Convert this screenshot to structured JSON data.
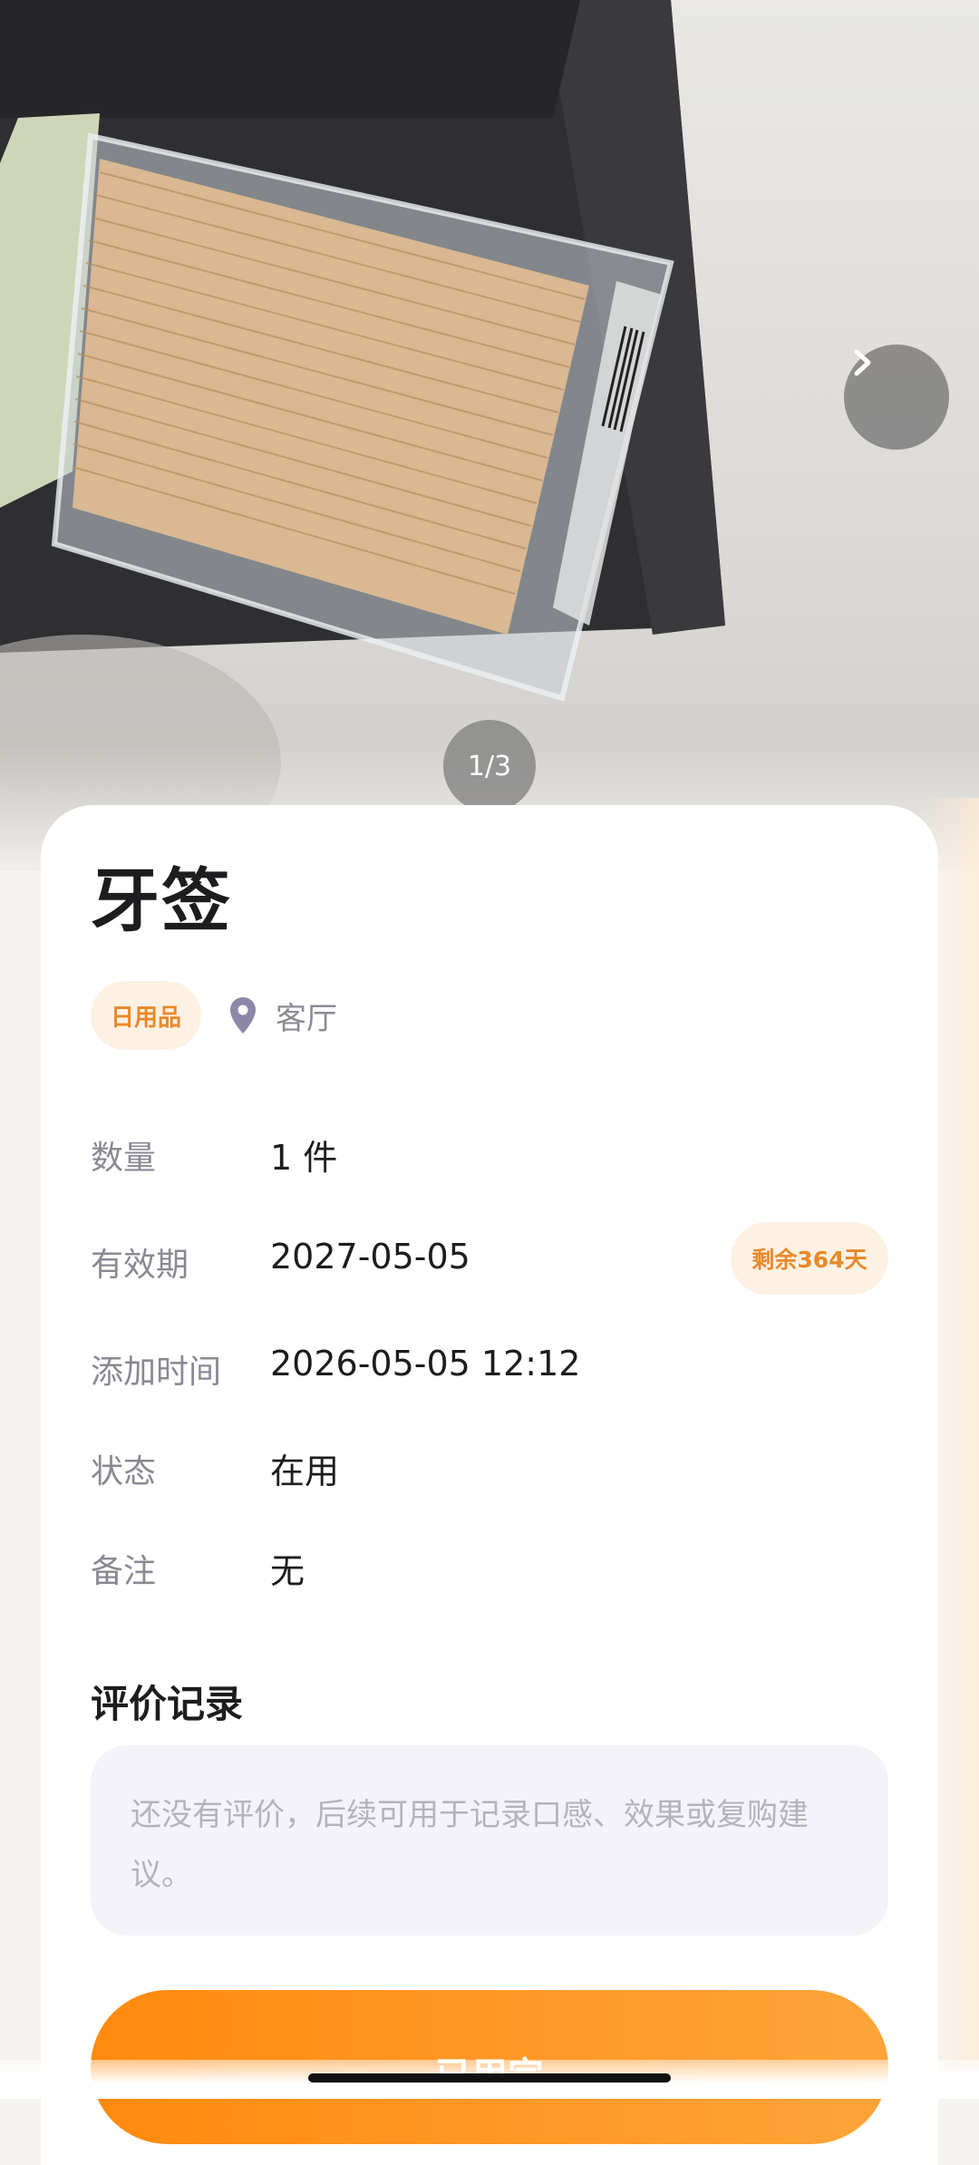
{
  "gallery": {
    "counter": "1/3",
    "next_icon": "chevron-right-icon"
  },
  "item": {
    "title": "牙签",
    "category_tag": "日用品",
    "location": "客厅",
    "location_icon": "location-pin-icon"
  },
  "details": [
    {
      "label": "数量",
      "value": "1 件"
    },
    {
      "label": "有效期",
      "value": "2027-05-05",
      "badge": "剩余364天"
    },
    {
      "label": "添加时间",
      "value": "2026-05-05 12:12"
    },
    {
      "label": "状态",
      "value": "在用"
    },
    {
      "label": "备注",
      "value": "无"
    }
  ],
  "reviews": {
    "title": "评价记录",
    "empty_text": "还没有评价，后续可用于记录口感、效果或复购建议。"
  },
  "bottom_button": {
    "label": "已用完"
  },
  "colors": {
    "accent": "#ff8a0f",
    "tag_bg": "#fdf1e4",
    "tag_text": "#e8892a"
  }
}
